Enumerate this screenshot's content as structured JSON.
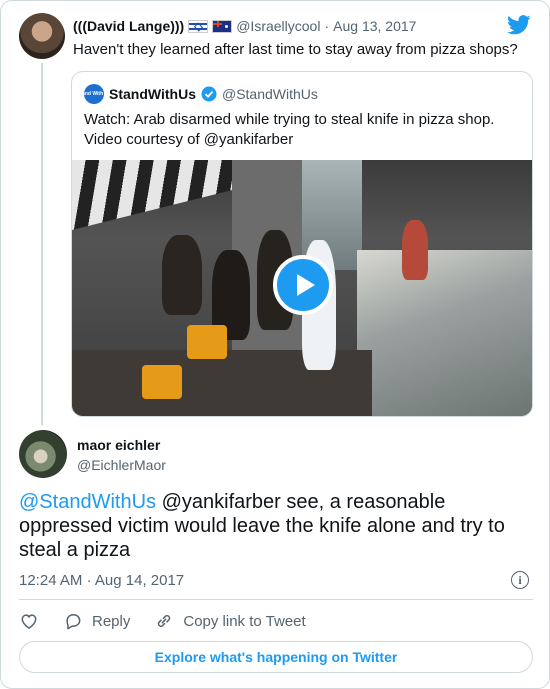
{
  "colors": {
    "accent": "#1d9bf0",
    "text": "#0f1419",
    "muted": "#536471",
    "border": "#cfd9de"
  },
  "parent_tweet": {
    "display_name": "(((David Lange)))",
    "flags": [
      "flag-israel-icon",
      "flag-australia-icon"
    ],
    "handle": "@Israellycool",
    "separator": "·",
    "date": "Aug 13, 2017",
    "text": "Haven't they learned after last time to stay away from pizza shops?"
  },
  "quoted_tweet": {
    "avatar_text": "Stand With Us",
    "display_name": "StandWithUs",
    "handle": "@StandWithUs",
    "text_line1": "Watch: Arab disarmed while trying to steal knife in pizza shop.",
    "text_line2": "Video courtesy of @yankifarber"
  },
  "reply_tweet": {
    "display_name": "maor eichler",
    "handle": "@EichlerMaor",
    "mention": "@StandWithUs",
    "text": " @yankifarber see, a reasonable oppressed victim would leave the knife alone and try to steal a pizza",
    "time": "12:24 AM",
    "separator": "·",
    "date": "Aug 14, 2017",
    "info_glyph": "i"
  },
  "actions": {
    "reply_label": "Reply",
    "copy_link_label": "Copy link to Tweet"
  },
  "explore_label": "Explore what's happening on Twitter"
}
